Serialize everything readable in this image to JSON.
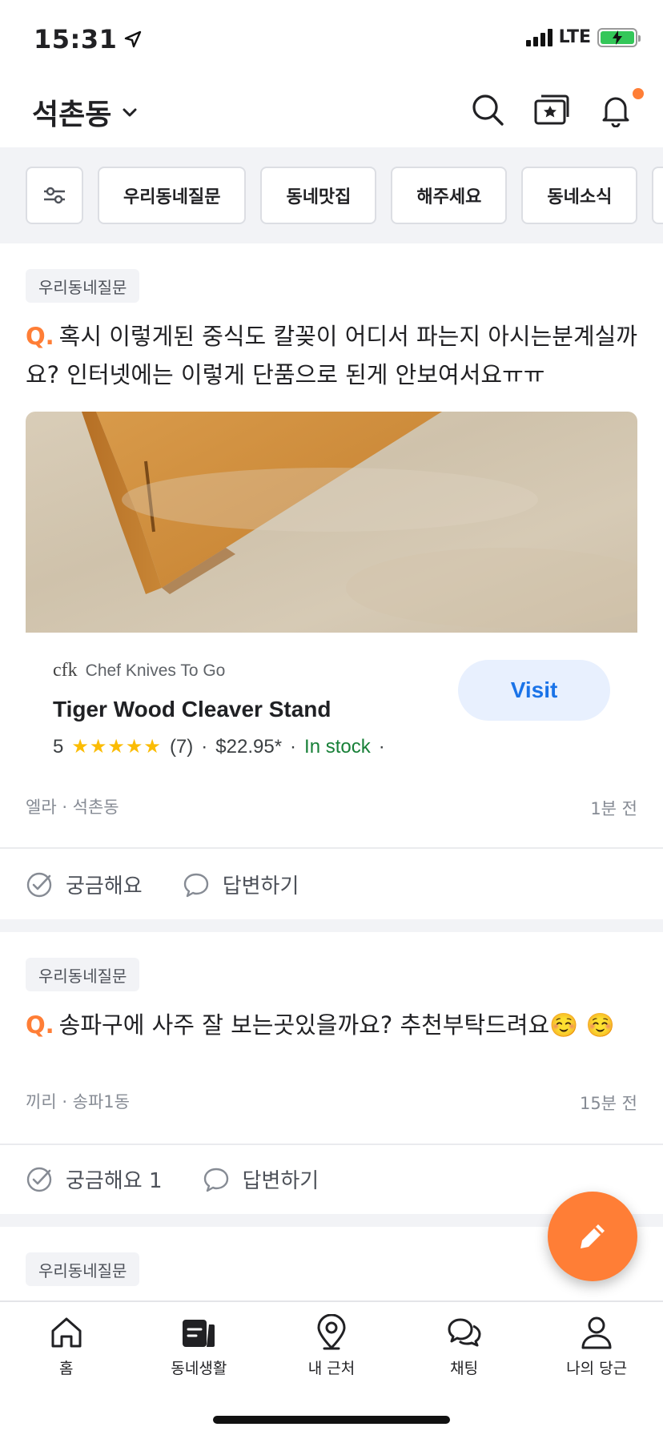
{
  "status_bar": {
    "time": "15:31",
    "network": "LTE"
  },
  "header": {
    "location": "석촌동"
  },
  "filters": {
    "chips": [
      "우리동네질문",
      "동네맛집",
      "해주세요",
      "동네소식"
    ]
  },
  "posts": [
    {
      "tag": "우리동네질문",
      "q_prefix": "Q.",
      "question": "혹시 이렇게된 중식도 칼꽂이 어디서 파는지 아시는분계실까요? 인터넷에는 이렇게 단품으로 된게 안보여서요ㅠㅠ",
      "author": "엘라 · 석촌동",
      "time": "1분 전",
      "curious_label": "궁금해요",
      "answer_label": "답변하기",
      "card": {
        "brand_logo": "cfk",
        "brand_name": "Chef Knives To Go",
        "product_title": "Tiger Wood Cleaver Stand",
        "rating": "5",
        "stars": "★★★★★",
        "reviews": "(7)",
        "price": "$22.95*",
        "availability": "In stock",
        "visit_label": "Visit"
      }
    },
    {
      "tag": "우리동네질문",
      "q_prefix": "Q.",
      "question": "송파구에 사주 잘 보는곳있을까요? 추천부탁드려요☺️ ☺️",
      "author": "끼리 · 송파1동",
      "time": "15분 전",
      "curious_label": "궁금해요 1",
      "answer_label": "답변하기"
    },
    {
      "tag": "우리동네질문"
    }
  ],
  "bottom_nav": {
    "items": [
      "홈",
      "동네생활",
      "내 근처",
      "채팅",
      "나의 당근"
    ]
  },
  "colors": {
    "accent": "#ff7e36",
    "text": "#212124",
    "muted": "#868b94"
  }
}
